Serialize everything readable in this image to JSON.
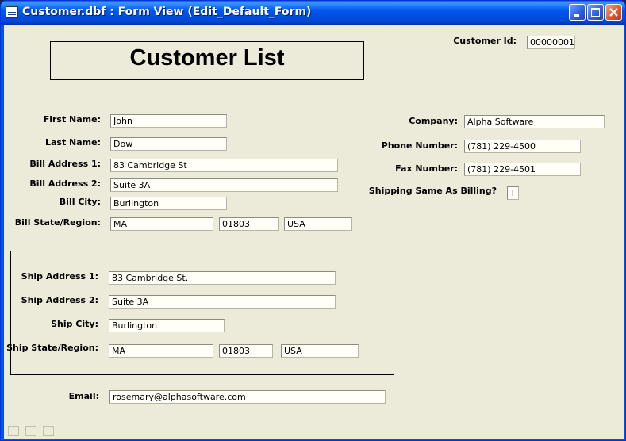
{
  "window": {
    "title": "Customer.dbf : Form View (Edit_Default_Form)"
  },
  "form": {
    "heading": "Customer List",
    "customer_id": {
      "label": "Customer Id:",
      "value": "00000001"
    },
    "first_name": {
      "label": "First Name:",
      "value": "John"
    },
    "last_name": {
      "label": "Last Name:",
      "value": "Dow"
    },
    "bill_address1": {
      "label": "Bill Address 1:",
      "value": "83 Cambridge St"
    },
    "bill_address2": {
      "label": "Bill Address 2:",
      "value": "Suite 3A"
    },
    "bill_city": {
      "label": "Bill City:",
      "value": "Burlington"
    },
    "bill_state_region": {
      "label": "Bill State/Region:",
      "state": "MA",
      "zip": "01803",
      "country": "USA"
    },
    "company": {
      "label": "Company:",
      "value": "Alpha Software"
    },
    "phone": {
      "label": "Phone Number:",
      "value": "(781) 229-4500"
    },
    "fax": {
      "label": "Fax Number:",
      "value": "(781) 229-4501"
    },
    "shipping_same": {
      "label": "Shipping Same As Billing?",
      "value": "T"
    },
    "ship_address1": {
      "label": "Ship Address 1:",
      "value": "83 Cambridge St."
    },
    "ship_address2": {
      "label": "Ship Address 2:",
      "value": "Suite 3A"
    },
    "ship_city": {
      "label": "Ship City:",
      "value": "Burlington"
    },
    "ship_state_region": {
      "label": "Ship State/Region:",
      "state": "MA",
      "zip": "01803",
      "country": "USA"
    },
    "email": {
      "label": "Email:",
      "value": "rosemary@alphasoftware.com"
    }
  }
}
